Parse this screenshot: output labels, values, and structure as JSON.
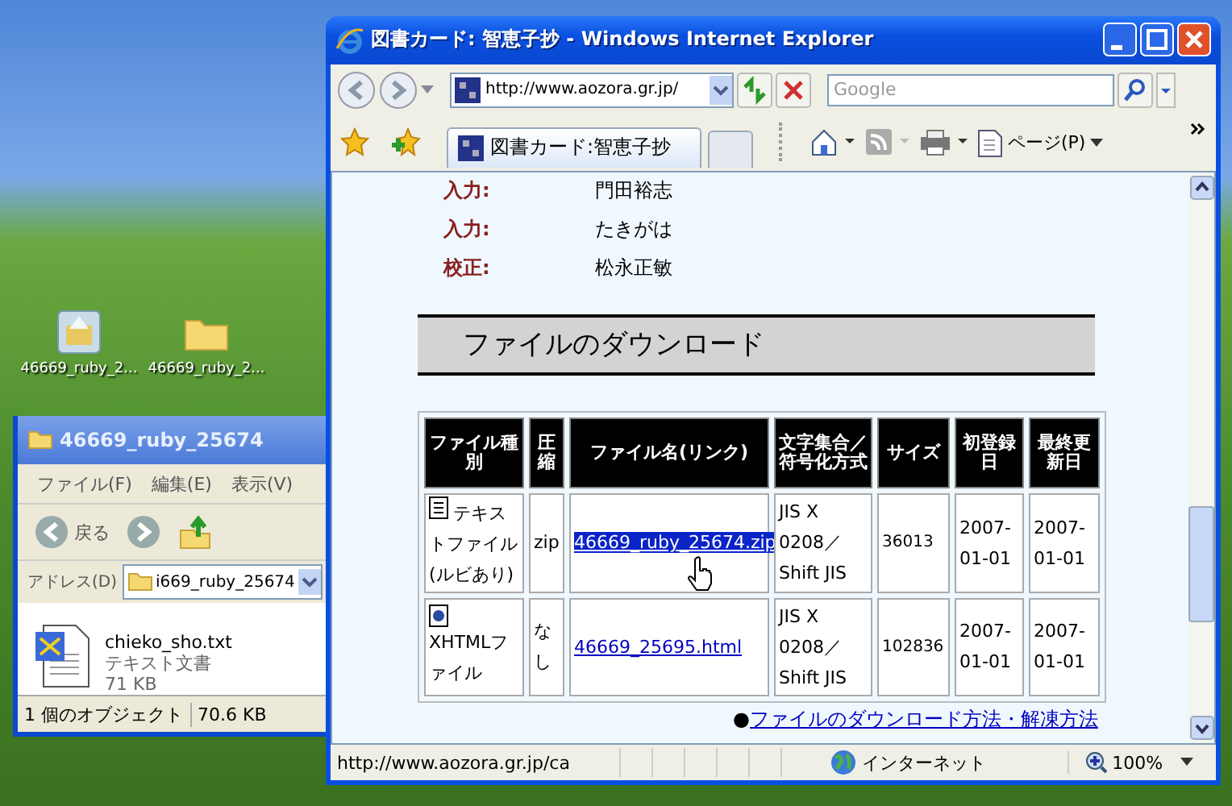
{
  "desktop_icons": [
    {
      "label": "46669_ruby_2...",
      "kind": "archive"
    },
    {
      "label": "46669_ruby_2...",
      "kind": "folder"
    }
  ],
  "explorer": {
    "title": "46669_ruby_25674",
    "menu": [
      "ファイル(F)",
      "編集(E)",
      "表示(V)"
    ],
    "back_label": "戻る",
    "address_label": "アドレス(D)",
    "address": "i669_ruby_25674",
    "file": {
      "name": "chieko_sho.txt",
      "type": "テキスト文書",
      "size": "71 KB"
    },
    "status": [
      "1 個のオブジェクト",
      "70.6 KB"
    ]
  },
  "browser": {
    "title": "図書カード: 智恵子抄 - Windows Internet Explorer",
    "url": "http://www.aozora.gr.jp/",
    "search_placeholder": "Google",
    "tabs": [
      {
        "label": "図書カード:智恵子抄",
        "selected": true
      }
    ],
    "page_menu": "ページ(P)",
    "credits": [
      {
        "label": "入力:",
        "value": "門田裕志"
      },
      {
        "label": "入力:",
        "value": "たきがは"
      },
      {
        "label": "校正:",
        "value": "松永正敏"
      }
    ],
    "section_heading": "ファイルのダウンロード",
    "table": {
      "columns": [
        "ファイル種別",
        "圧縮",
        "ファイル名(リンク)",
        "文字集合／符号化方式",
        "サイズ",
        "初登録日",
        "最終更新日"
      ],
      "rows": [
        {
          "kind": "text",
          "type": "テキストファイル(ルビあり)",
          "compression": "zip",
          "file": "46669_ruby_25674.zip",
          "selected": true,
          "encoding": "JIS X 0208／Shift JIS",
          "size": "36013",
          "created": "2007-01-01",
          "updated": "2007-01-01"
        },
        {
          "kind": "xhtml",
          "type": "XHTMLファイル",
          "compression": "なし",
          "file": "46669_25695.html",
          "selected": false,
          "encoding": "JIS X 0208／Shift JIS",
          "size": "102836",
          "created": "2007-01-01",
          "updated": "2007-01-01"
        }
      ]
    },
    "help_bullet": "●",
    "help_link": "ファイルのダウンロード方法・解凍方法",
    "status_bar": {
      "url": "http://www.aozora.gr.jp/ca",
      "zone": "インターネット",
      "zoom": "100%"
    }
  }
}
